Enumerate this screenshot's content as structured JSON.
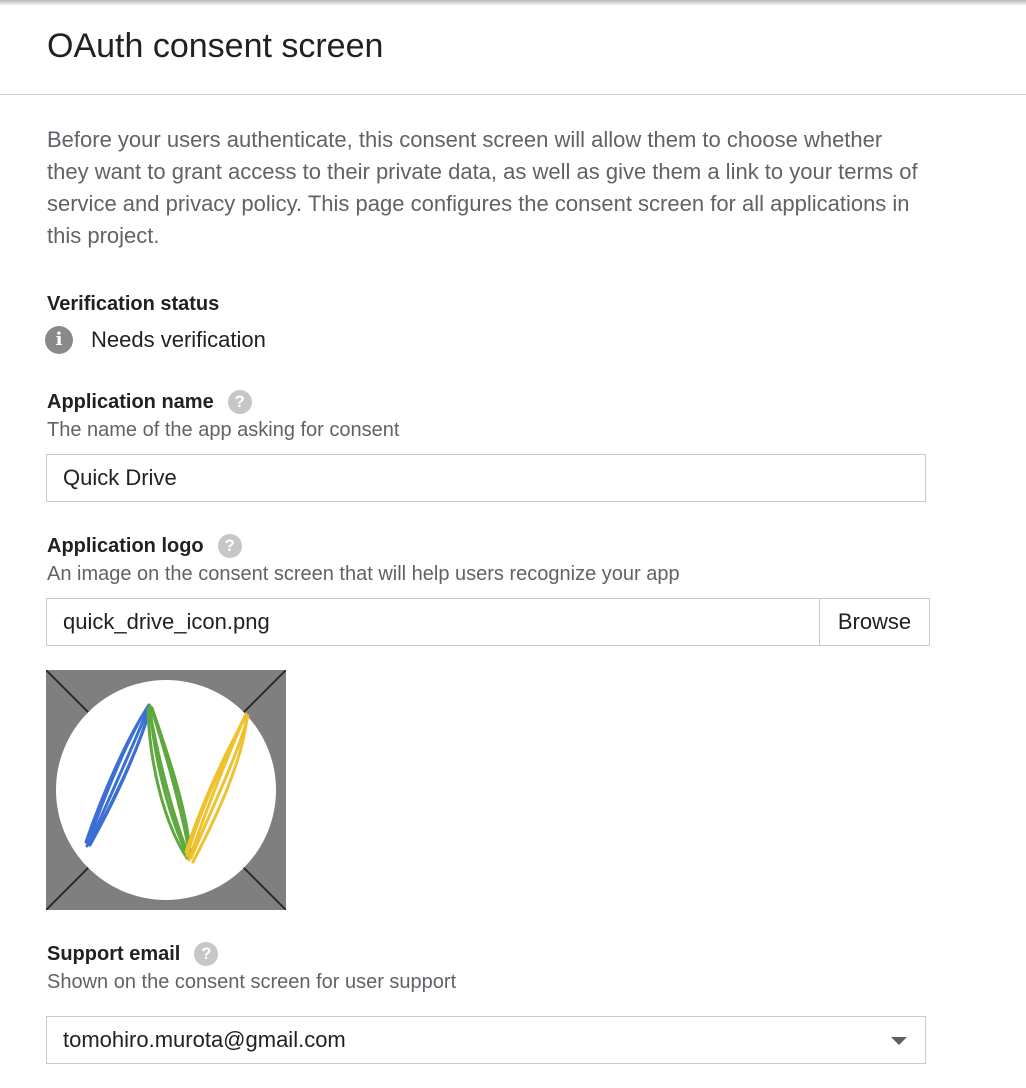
{
  "header": {
    "title": "OAuth consent screen"
  },
  "intro": "Before your users authenticate, this consent screen will allow them to choose whether they want to grant access to their private data, as well as give them a link to your terms of service and privacy policy. This page configures the consent screen for all applications in this project.",
  "verification": {
    "label": "Verification status",
    "icon": "info-icon",
    "status": "Needs verification"
  },
  "app_name": {
    "label": "Application name",
    "help_icon": "?",
    "hint": "The name of the app asking for consent",
    "value": "Quick Drive"
  },
  "app_logo": {
    "label": "Application logo",
    "help_icon": "?",
    "hint": "An image on the consent screen that will help users recognize your app",
    "file_value": "quick_drive_icon.png",
    "browse_label": "Browse",
    "colors": {
      "blue": "#3b6fd4",
      "green": "#5ea93f",
      "yellow": "#efc12d"
    }
  },
  "support_email": {
    "label": "Support email",
    "help_icon": "?",
    "hint": "Shown on the consent screen for user support",
    "value": "tomohiro.murota@gmail.com"
  }
}
